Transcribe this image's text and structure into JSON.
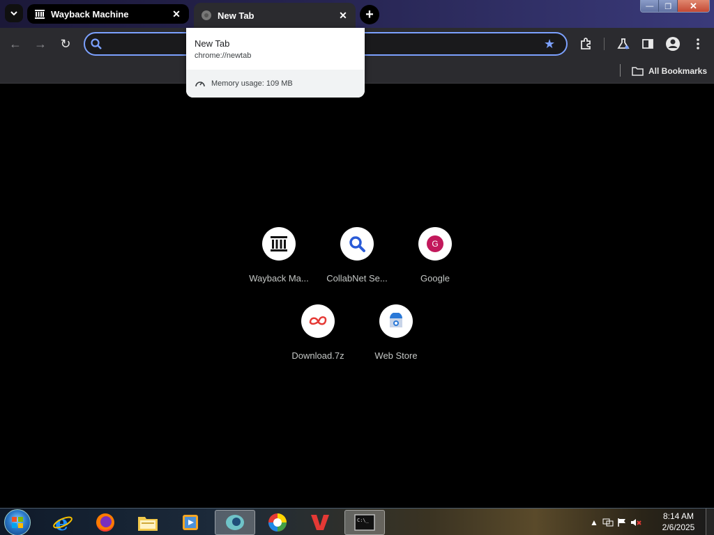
{
  "tabs": [
    {
      "title": "Wayback Machine",
      "icon": "wayback-icon",
      "active": true
    },
    {
      "title": "New Tab",
      "icon": "globe-icon",
      "active": false
    }
  ],
  "tab_search_icon": "chevron-down-icon",
  "new_tab_symbol": "+",
  "window_controls": {
    "min": "—",
    "max": "❐",
    "close": "✕"
  },
  "toolbar": {
    "back_icon": "←",
    "forward_icon": "→",
    "reload_icon": "↻",
    "omnibox_value": "",
    "bookmark_star": "★"
  },
  "bookmarks_bar": {
    "all_bookmarks_label": "All Bookmarks"
  },
  "hover_card": {
    "title": "New Tab",
    "url": "chrome://newtab",
    "memory": "Memory usage: 109 MB"
  },
  "shortcuts": [
    {
      "label": "Wayback Ma...",
      "icon": "wayback-icon"
    },
    {
      "label": "CollabNet Se...",
      "icon": "search-icon"
    },
    {
      "label": "Google",
      "icon": "google-g-icon",
      "letter": "G"
    },
    {
      "label": "Download.7z",
      "icon": "download-7z-icon"
    },
    {
      "label": "Web Store",
      "icon": "web-store-icon"
    }
  ],
  "taskbar": {
    "apps": [
      "internet-explorer-icon",
      "firefox-icon",
      "file-explorer-icon",
      "media-player-icon",
      "chromium-icon",
      "color-wheel-icon",
      "wps-office-icon",
      "cmd-icon"
    ],
    "clock_time": "8:14 AM",
    "clock_date": "2/6/2025"
  },
  "colors": {
    "accent": "#7ca1ff",
    "toolbar_bg": "#2b2b2f",
    "content_bg": "#000000"
  }
}
